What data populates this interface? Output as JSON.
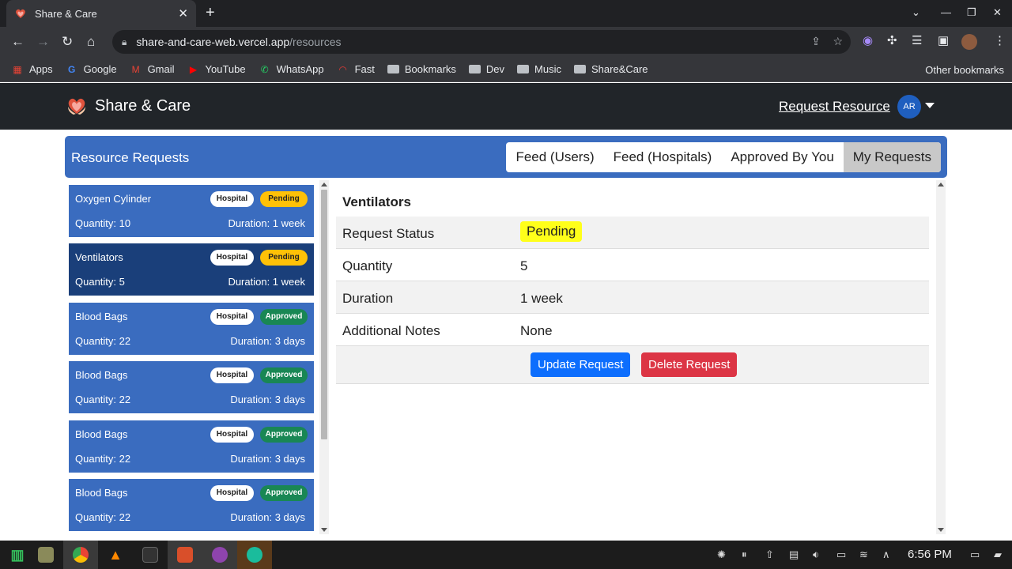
{
  "browser": {
    "tab_title": "Share & Care",
    "url_host": "share-and-care-web.vercel.app",
    "url_path": "/resources",
    "bookmarks": [
      "Apps",
      "Google",
      "Gmail",
      "YouTube",
      "WhatsApp",
      "Fast",
      "Bookmarks",
      "Dev",
      "Music",
      "Share&Care"
    ],
    "other_bookmarks": "Other bookmarks"
  },
  "navbar": {
    "brand": "Share & Care",
    "request_link": "Request Resource",
    "avatar_initials": "AR"
  },
  "header": {
    "title": "Resource Requests",
    "tabs": [
      "Feed (Users)",
      "Feed (Hospitals)",
      "Approved By You",
      "My Requests"
    ],
    "active_tab": "My Requests"
  },
  "requests": [
    {
      "name": "Oxygen Cylinder",
      "type": "Hospital",
      "status": "Pending",
      "quantity": "Quantity: 10",
      "duration": "Duration: 1 week"
    },
    {
      "name": "Ventilators",
      "type": "Hospital",
      "status": "Pending",
      "quantity": "Quantity: 5",
      "duration": "Duration: 1 week"
    },
    {
      "name": "Blood Bags",
      "type": "Hospital",
      "status": "Approved",
      "quantity": "Quantity: 22",
      "duration": "Duration: 3 days"
    },
    {
      "name": "Blood Bags",
      "type": "Hospital",
      "status": "Approved",
      "quantity": "Quantity: 22",
      "duration": "Duration: 3 days"
    },
    {
      "name": "Blood Bags",
      "type": "Hospital",
      "status": "Approved",
      "quantity": "Quantity: 22",
      "duration": "Duration: 3 days"
    },
    {
      "name": "Blood Bags",
      "type": "Hospital",
      "status": "Approved",
      "quantity": "Quantity: 22",
      "duration": "Duration: 3 days"
    }
  ],
  "selected_index": 1,
  "detail": {
    "title": "Ventilators",
    "rows": [
      {
        "label": "Request Status",
        "value": "Pending"
      },
      {
        "label": "Quantity",
        "value": "5"
      },
      {
        "label": "Duration",
        "value": "1 week"
      },
      {
        "label": "Additional Notes",
        "value": "None"
      }
    ],
    "update_label": "Update Request",
    "delete_label": "Delete Request"
  },
  "colors": {
    "pending": "#ffc107",
    "approved": "#198754",
    "card": "#3a6cbf",
    "card_selected": "#1a3f7a"
  },
  "taskbar": {
    "clock": "6:56 PM"
  }
}
